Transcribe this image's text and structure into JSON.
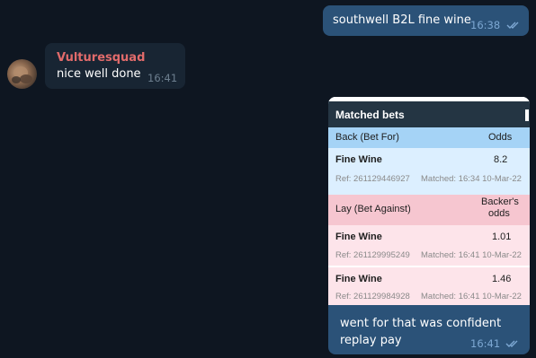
{
  "messages": {
    "outgoing_first": {
      "text": "southwell B2L fine wine",
      "time": "16:38"
    },
    "incoming": {
      "sender": "Vulturesquad",
      "text": "nice well done",
      "time": "16:41"
    },
    "outgoing_media": {
      "caption_line1": "went for that was confident",
      "caption_line2": "replay pay",
      "time": "16:41"
    }
  },
  "screenshot": {
    "title": "Matched bets",
    "back": {
      "header": "Back (Bet For)",
      "odds_header": "Odds",
      "bets": [
        {
          "selection": "Fine Wine",
          "odds": "8.2",
          "ref": "Ref: 261129446927",
          "matched": "Matched: 16:34 10-Mar-22"
        }
      ]
    },
    "lay": {
      "header": "Lay (Bet Against)",
      "odds_header_line1": "Backer's",
      "odds_header_line2": "odds",
      "bets": [
        {
          "selection": "Fine Wine",
          "odds": "1.01",
          "ref": "Ref: 261129995249",
          "matched": "Matched: 16:41 10-Mar-22"
        },
        {
          "selection": "Fine Wine",
          "odds": "1.46",
          "ref": "Ref: 261129984928",
          "matched": "Matched: 16:41 10-Mar-22"
        }
      ]
    }
  },
  "colors": {
    "background": "#0e1621",
    "outgoing_bubble": "#2b5278",
    "incoming_bubble": "#182533",
    "sender_name": "#e16b6b",
    "back_header": "#a5d3f6",
    "lay_header": "#f6c6d0"
  },
  "icons": {
    "read_receipt": "double-check-icon"
  }
}
